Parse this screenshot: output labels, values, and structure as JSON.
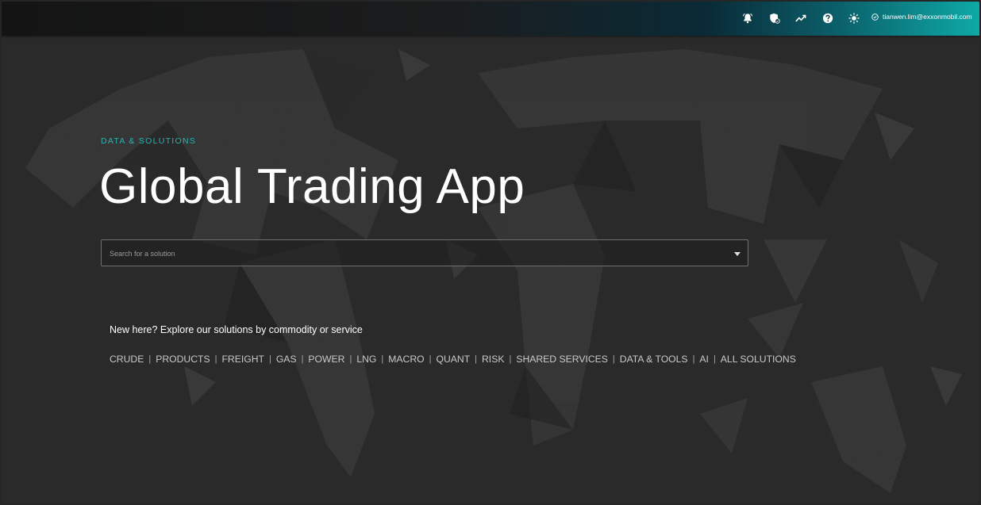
{
  "colors": {
    "accent": "#2ab3b1",
    "background": "#2a2a2a",
    "topbar_end": "#0ea9a6"
  },
  "topbar": {
    "icons": [
      "bell-icon",
      "shield-badge-icon",
      "trending-icon",
      "help-icon",
      "brightness-icon",
      "verified-check-icon"
    ],
    "user_email": "tianwen.lim@exxonmobil.com"
  },
  "hero": {
    "eyebrow": "DATA & SOLUTIONS",
    "title": "Global Trading App"
  },
  "search": {
    "placeholder": "Search for a solution",
    "value": ""
  },
  "explore": {
    "intro": "New here? Explore our solutions by commodity or service",
    "separator": "|",
    "links": [
      "CRUDE",
      "PRODUCTS",
      "FREIGHT",
      "GAS",
      "POWER",
      "LNG",
      "MACRO",
      "QUANT",
      "RISK",
      "SHARED SERVICES",
      "DATA & TOOLS",
      "AI",
      "ALL SOLUTIONS"
    ]
  }
}
